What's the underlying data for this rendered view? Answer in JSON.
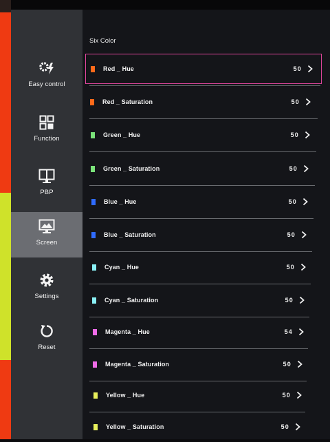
{
  "colors": {
    "desktop_red": "#ef3a12",
    "desktop_lime": "#cfe22a",
    "sidebar_bg": "#303236",
    "sidebar_active": "#6b6d72",
    "panel_bg": "#141519",
    "selection_border": "#e0459c"
  },
  "sidebar": {
    "items": [
      {
        "label": "Easy control",
        "icon": "easy-control-icon"
      },
      {
        "label": "Function",
        "icon": "function-grid-icon"
      },
      {
        "label": "PBP",
        "icon": "pbp-monitor-icon"
      },
      {
        "label": "Screen",
        "icon": "screen-monitor-icon",
        "active": true
      },
      {
        "label": "Settings",
        "icon": "gear-icon"
      },
      {
        "label": "Reset",
        "icon": "reset-icon"
      }
    ]
  },
  "panel": {
    "title": "Six Color",
    "rows": [
      {
        "label": "Red _ Hue",
        "value": "50",
        "swatch": "#ff6a1a",
        "selected": true
      },
      {
        "label": "Red _ Saturation",
        "value": "50",
        "swatch": "#ff6a1a"
      },
      {
        "label": "Green _ Hue",
        "value": "50",
        "swatch": "#7be37a"
      },
      {
        "label": "Green _ Saturation",
        "value": "50",
        "swatch": "#7be37a"
      },
      {
        "label": "Blue _ Hue",
        "value": "50",
        "swatch": "#2f6bff"
      },
      {
        "label": "Blue _ Saturation",
        "value": "50",
        "swatch": "#2f6bff"
      },
      {
        "label": "Cyan _ Hue",
        "value": "50",
        "swatch": "#8af0f5"
      },
      {
        "label": "Cyan _ Saturation",
        "value": "50",
        "swatch": "#8af0f5"
      },
      {
        "label": "Magenta _ Hue",
        "value": "54",
        "swatch": "#f06ce8"
      },
      {
        "label": "Magenta _ Saturation",
        "value": "50",
        "swatch": "#f06ce8"
      },
      {
        "label": "Yellow _ Hue",
        "value": "50",
        "swatch": "#e8f05c"
      },
      {
        "label": "Yellow _ Saturation",
        "value": "50",
        "swatch": "#e8f05c"
      }
    ]
  }
}
